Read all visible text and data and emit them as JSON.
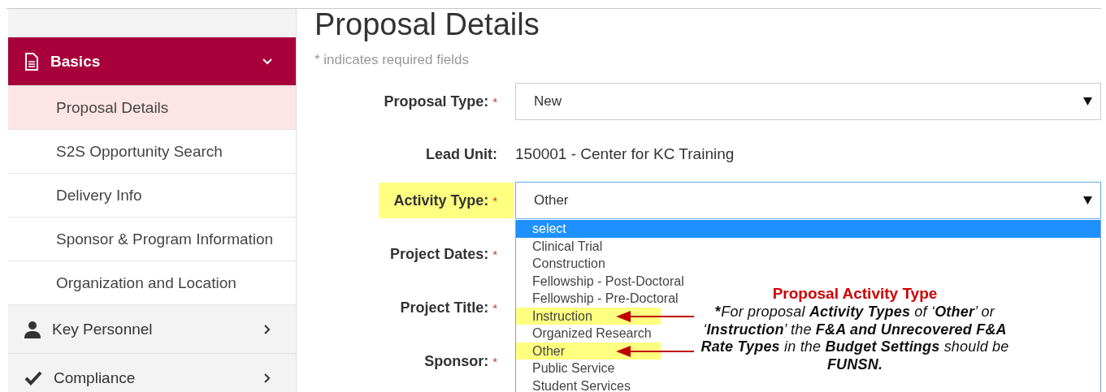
{
  "sidebar": {
    "sections": [
      {
        "label": "Basics",
        "expanded": true,
        "selected": true,
        "items": [
          {
            "label": "Proposal Details",
            "selected": true
          },
          {
            "label": "S2S Opportunity Search",
            "selected": false
          },
          {
            "label": "Delivery Info",
            "selected": false
          },
          {
            "label": "Sponsor & Program Information",
            "selected": false
          },
          {
            "label": "Organization and Location",
            "selected": false
          }
        ]
      },
      {
        "label": "Key Personnel",
        "expanded": false,
        "selected": false
      },
      {
        "label": "Compliance",
        "expanded": false,
        "selected": false
      }
    ]
  },
  "page": {
    "title": "Proposal Details",
    "subtitle": "* indicates required fields"
  },
  "form": {
    "fields": [
      {
        "kind": "select",
        "label": "Proposal Type:",
        "required_mark": "*",
        "value": "New",
        "highlighted": false,
        "open": false
      },
      {
        "kind": "text",
        "label": "Lead Unit:",
        "value": "150001 - Center for KC Training",
        "highlighted": false
      },
      {
        "kind": "select",
        "label": "Activity Type:",
        "required_mark": "*",
        "value": "Other",
        "highlighted": true,
        "open": true
      },
      {
        "kind": "covered",
        "label": "Project Dates:",
        "required_mark": "*",
        "highlighted": false
      },
      {
        "kind": "covered",
        "label": "Project Title:",
        "required_mark": "*",
        "highlighted": false
      },
      {
        "kind": "covered",
        "label": "Sponsor:",
        "required_mark": "*",
        "highlighted": false
      }
    ]
  },
  "dropdown": {
    "options": [
      {
        "label": "select",
        "selected": true,
        "highlighted": false
      },
      {
        "label": "Clinical Trial",
        "selected": false,
        "highlighted": false
      },
      {
        "label": "Construction",
        "selected": false,
        "highlighted": false
      },
      {
        "label": "Fellowship - Post-Doctoral",
        "selected": false,
        "highlighted": false
      },
      {
        "label": "Fellowship - Pre-Doctoral",
        "selected": false,
        "highlighted": false
      },
      {
        "label": "Instruction",
        "selected": false,
        "highlighted": true
      },
      {
        "label": "Organized Research",
        "selected": false,
        "highlighted": false
      },
      {
        "label": "Other",
        "selected": false,
        "highlighted": true
      },
      {
        "label": "Public Service",
        "selected": false,
        "highlighted": false
      },
      {
        "label": "Student Services",
        "selected": false,
        "highlighted": false
      }
    ]
  },
  "callout": {
    "title": "Proposal Activity Type",
    "mark": "*",
    "text": "For proposal **Activity Types** of ‘**Other**’ or ‘**Instruction**’ the **F&A and Unrecovered F&A Rate Types** in the **Budget Settings** should be **FUNSN.**"
  }
}
